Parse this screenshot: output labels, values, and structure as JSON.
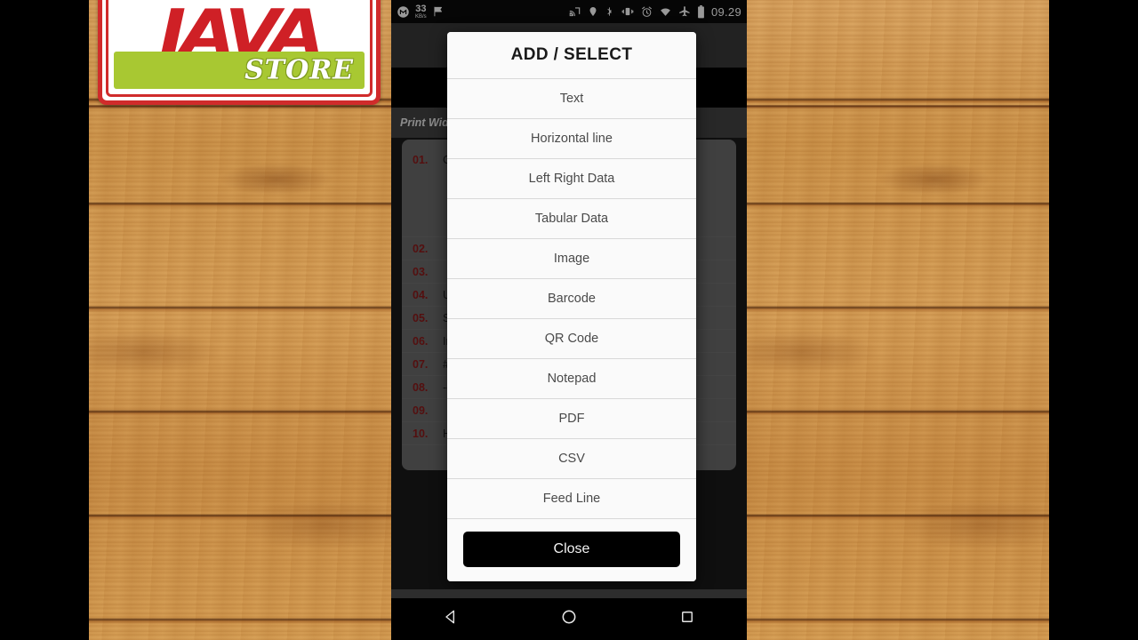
{
  "branding": {
    "logo_primary": "JAVA",
    "logo_secondary": "STORE",
    "logo_red": "#cf2026",
    "logo_green": "#a8c832"
  },
  "statusbar": {
    "network_speed_value": "33",
    "network_speed_unit": "KB/s",
    "clock": "09.29",
    "icons_left": [
      "metro-app-icon",
      "flag-icon"
    ],
    "icons_right": [
      "cast-icon",
      "location-icon",
      "bluetooth-icon",
      "vibrate-icon",
      "alarm-icon",
      "wifi-icon",
      "airplane-mode-icon",
      "battery-icon"
    ]
  },
  "app": {
    "print_width_label": "Print Width",
    "list_rows": [
      {
        "num": "01.",
        "text": "CE"
      },
      {
        "num": "02.",
        "text": ""
      },
      {
        "num": "03.",
        "text": ""
      },
      {
        "num": "04.",
        "text": "Us"
      },
      {
        "num": "05.",
        "text": "Stt"
      },
      {
        "num": "06.",
        "text": "Inf"
      },
      {
        "num": "07.",
        "text": "#d"
      },
      {
        "num": "08.",
        "text": "---"
      },
      {
        "num": "09.",
        "text": ""
      },
      {
        "num": "10.",
        "text": "Ha"
      }
    ]
  },
  "dialog": {
    "title": "ADD / SELECT",
    "items": [
      "Text",
      "Horizontal line",
      "Left Right Data",
      "Tabular Data",
      "Image",
      "Barcode",
      "QR Code",
      "Notepad",
      "PDF",
      "CSV",
      "Feed Line"
    ],
    "close_label": "Close"
  },
  "navbar": {
    "back": "back-triangle-icon",
    "home": "home-circle-icon",
    "recents": "recents-square-icon"
  }
}
